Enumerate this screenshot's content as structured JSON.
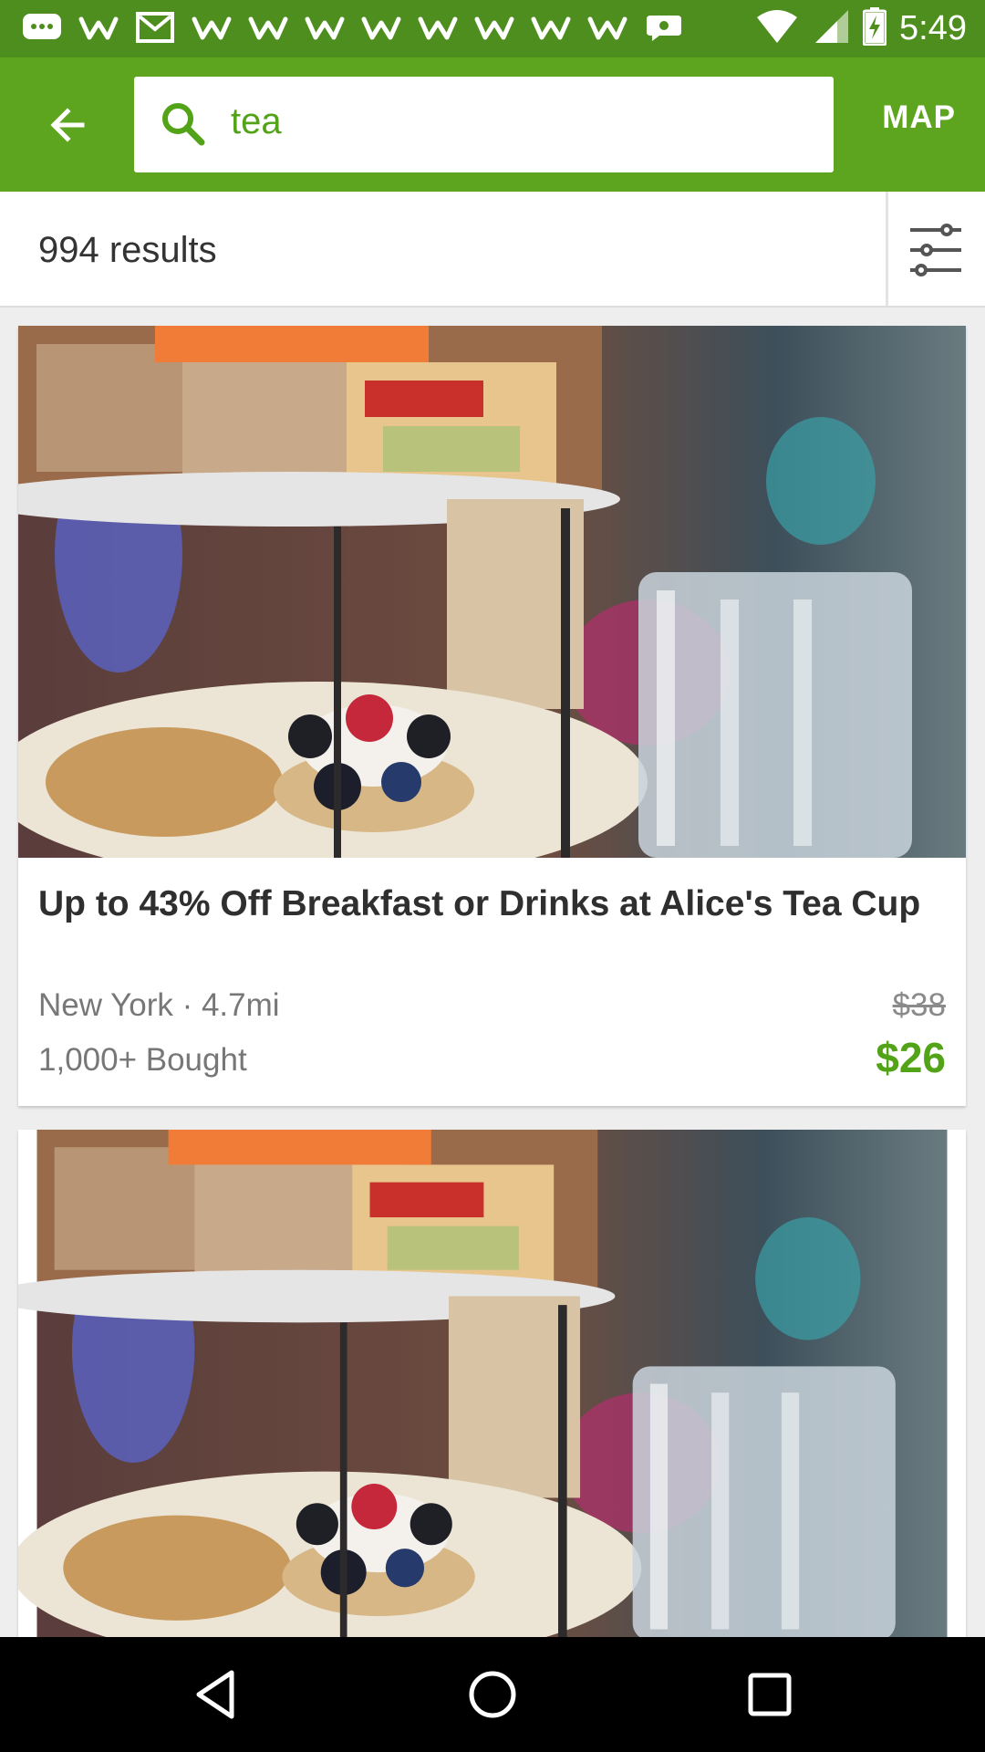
{
  "status_bar": {
    "time": "5:49",
    "icons": [
      "messages-icon",
      "app-w-icon",
      "gmail-icon",
      "app-w-icon",
      "app-w-icon",
      "app-w-icon",
      "app-w-icon",
      "app-w-icon",
      "app-w-icon",
      "app-w-icon",
      "app-w-icon",
      "chat-bubble-icon",
      "wifi-icon",
      "signal-icon",
      "battery-charging-icon"
    ]
  },
  "header": {
    "search_query": "tea",
    "map_label": "MAP"
  },
  "results": {
    "count_label": "994 results"
  },
  "deals": [
    {
      "title": "Up to 43% Off Breakfast or Drinks at Alice's Tea Cup",
      "location": "New York · 4.7mi",
      "bought": "1,000+ Bought",
      "original_price": "$38",
      "price": "$26"
    }
  ],
  "colors": {
    "status_bar": "#4e8e1e",
    "app_bar": "#5ea51f",
    "accent_green": "#53a318"
  }
}
